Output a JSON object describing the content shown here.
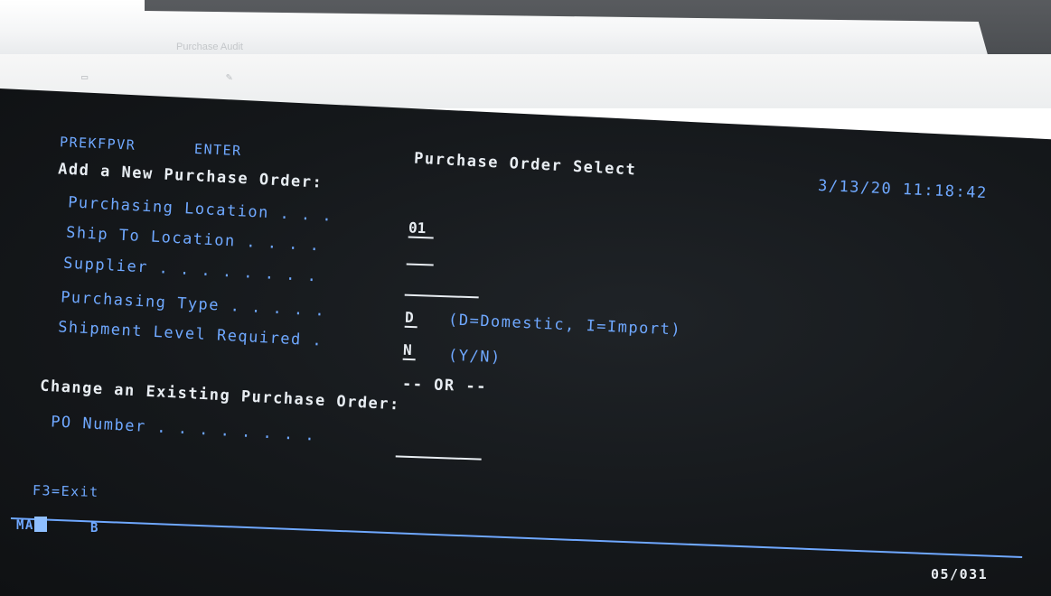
{
  "window": {
    "title": "Purchase Audit"
  },
  "header": {
    "program_name": "PREKFPVR",
    "mode": "ENTER",
    "screen_title": "Purchase Order Select",
    "datetime": "3/13/20 11:18:42"
  },
  "add_section": {
    "heading": "Add a New Purchase Order:",
    "fields": [
      {
        "label": "Purchasing Location . . .",
        "value": "01"
      },
      {
        "label": "Ship To Location . . . .",
        "value": ""
      },
      {
        "label": "Supplier . . . . . . . .",
        "value": ""
      },
      {
        "label": "Purchasing Type . . . . .",
        "value": "D",
        "hint": "(D=Domestic, I=Import)"
      },
      {
        "label": "Shipment Level Required .",
        "value": "N",
        "hint": "(Y/N)"
      }
    ]
  },
  "or_separator": "-- OR --",
  "change_section": {
    "heading": "Change an Existing Purchase Order:",
    "po_number_label": "PO Number . . . . . . . .",
    "po_number_value": ""
  },
  "function_keys": {
    "f3": "F3=Exit"
  },
  "status_line": {
    "left": "MA",
    "indicator": "B",
    "cursor_position": "05/031"
  },
  "colors": {
    "screen_bg": "#15181b",
    "field_label": "#6fa8ff",
    "input_text": "#e8edf2"
  }
}
